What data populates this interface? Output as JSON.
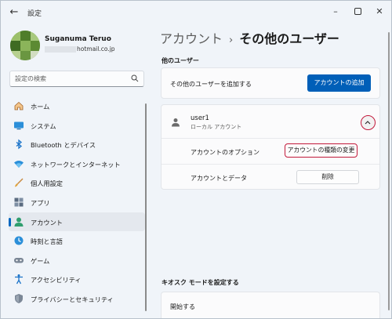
{
  "window": {
    "title": "設定",
    "back_icon": "back-arrow-icon",
    "controls": [
      "minimize-icon",
      "maximize-icon",
      "close-icon"
    ]
  },
  "profile": {
    "name": "Suganuma Teruo",
    "email_visible": "hotmail.co.jp"
  },
  "search": {
    "placeholder": "設定の検索",
    "icon": "search-icon"
  },
  "sidebar": {
    "items": [
      {
        "label": "ホーム",
        "icon": "home-icon"
      },
      {
        "label": "システム",
        "icon": "system-icon"
      },
      {
        "label": "Bluetooth とデバイス",
        "icon": "bluetooth-icon"
      },
      {
        "label": "ネットワークとインターネット",
        "icon": "network-icon"
      },
      {
        "label": "個人用設定",
        "icon": "personalization-icon"
      },
      {
        "label": "アプリ",
        "icon": "apps-icon"
      },
      {
        "label": "アカウント",
        "icon": "account-icon",
        "active": true
      },
      {
        "label": "時刻と言語",
        "icon": "time-language-icon"
      },
      {
        "label": "ゲーム",
        "icon": "gaming-icon"
      },
      {
        "label": "アクセシビリティ",
        "icon": "accessibility-icon"
      },
      {
        "label": "プライバシーとセキュリティ",
        "icon": "privacy-shield-icon"
      }
    ]
  },
  "breadcrumb": {
    "parent": "アカウント",
    "separator": "›",
    "current": "その他のユーザー"
  },
  "other_users": {
    "heading": "他のユーザー",
    "add_label": "その他のユーザーを追加する",
    "add_button": "アカウントの追加",
    "user": {
      "name": "user1",
      "type": "ローカル アカウント",
      "expanded": true,
      "options_label": "アカウントのオプション",
      "options_button": "アカウントの種類の変更",
      "data_label": "アカウントとデータ",
      "data_button": "削除"
    }
  },
  "kiosk": {
    "heading": "キオスク モードを設定する",
    "start_label": "開始する"
  },
  "colors": {
    "accent": "#005fb8",
    "highlight": "#c2183a",
    "background": "#f0f4f9"
  }
}
